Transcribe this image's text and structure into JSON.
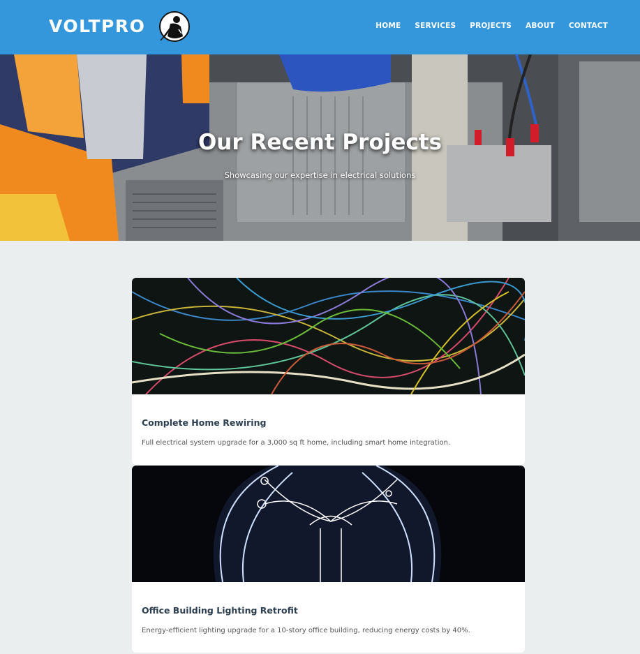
{
  "header": {
    "brand": "VOLTPRO",
    "logo_icon": "electrician-logo-icon",
    "nav": [
      "HOME",
      "SERVICES",
      "PROJECTS",
      "ABOUT",
      "CONTACT"
    ],
    "background_color": "#3497db"
  },
  "hero": {
    "title": "Our Recent Projects",
    "subtitle": "Showcasing our expertise in electrical solutions",
    "image": "electrician-working-on-panel-photo"
  },
  "projects": [
    {
      "title": "Complete Home Rewiring",
      "description": "Full electrical system upgrade for a 3,000 sq ft home, including smart home integration.",
      "image": "tangled-wires-photo"
    },
    {
      "title": "Office Building Lighting Retrofit",
      "description": "Energy-efficient lighting upgrade for a 10-story office building, reducing energy costs by 40%.",
      "image": "light-bulb-filament-photo"
    }
  ]
}
